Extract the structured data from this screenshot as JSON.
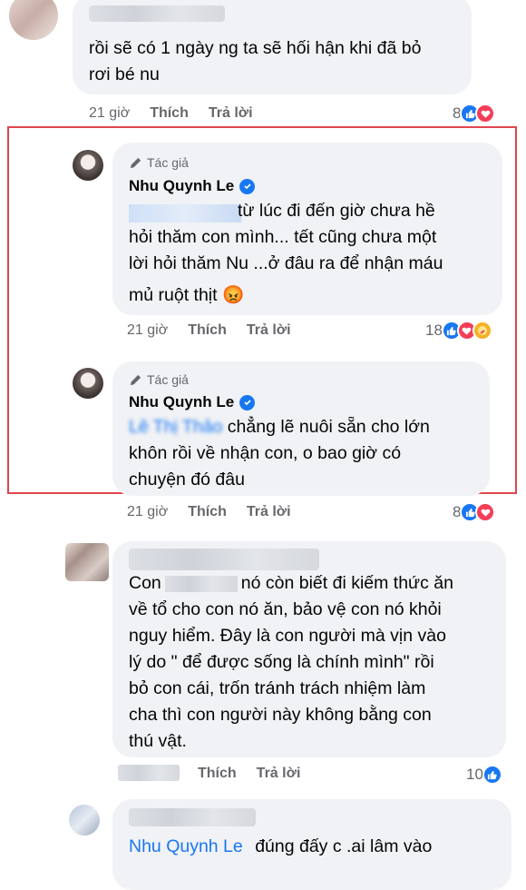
{
  "comments": [
    {
      "text_lines": [
        "rồi sẽ có 1 ngày ng ta sẽ hối hận khi đã bỏ",
        "rơi bé nu"
      ],
      "time": "21 giờ",
      "like_label": "Thích",
      "reply_label": "Trả lời",
      "reaction_count": "8",
      "reactions": [
        "like-icon",
        "love-icon"
      ]
    },
    {
      "author_badge": "Tác giả",
      "name": "Nhu Quynh Le",
      "lines": [
        "từ lúc đi đến giờ chưa hề",
        "hỏi thăm con mình... tết cũng chưa một",
        "lời hỏi thăm Nu ...ở đâu ra để nhận máu",
        "mủ ruột thịt 😡"
      ],
      "time": "21 giờ",
      "like_label": "Thích",
      "reply_label": "Trả lời",
      "reaction_count": "18",
      "reactions": [
        "like-icon",
        "love-icon",
        "care-icon"
      ]
    },
    {
      "author_badge": "Tác giả",
      "name": "Nhu Quynh Le",
      "mention": "Lê Thị Thảo",
      "lines": [
        "chẳng lẽ nuôi sẵn cho lớn",
        "khôn rồi về nhận con, o bao giờ có",
        "chuyện đó đâu"
      ],
      "time": "21 giờ",
      "like_label": "Thích",
      "reply_label": "Trả lời",
      "reaction_count": "8",
      "reactions": [
        "like-icon",
        "love-icon"
      ]
    },
    {
      "lines": [
        "Con",
        "nó còn biết đi kiếm thức ăn",
        "về tổ cho con nó ăn, bảo vệ con nó khỏi",
        "nguy hiểm. Đây là con người mà vịn vào",
        "lý do \" để được sống là chính mình\" rồi",
        "bỏ con cái, trốn tránh trách nhiệm làm",
        "cha thì con người này không bằng con",
        "thú vật."
      ],
      "like_label": "Thích",
      "reply_label": "Trả lời",
      "reaction_count": "10",
      "reactions": [
        "like-icon"
      ]
    },
    {
      "mention": "Nhu Quynh Le",
      "text": "đúng đấy c .ai lâm vào"
    }
  ],
  "colors": {
    "accent": "#1877f2",
    "frame": "#e0464f",
    "bubble": "#f0f2f5",
    "meta": "#65676b"
  }
}
